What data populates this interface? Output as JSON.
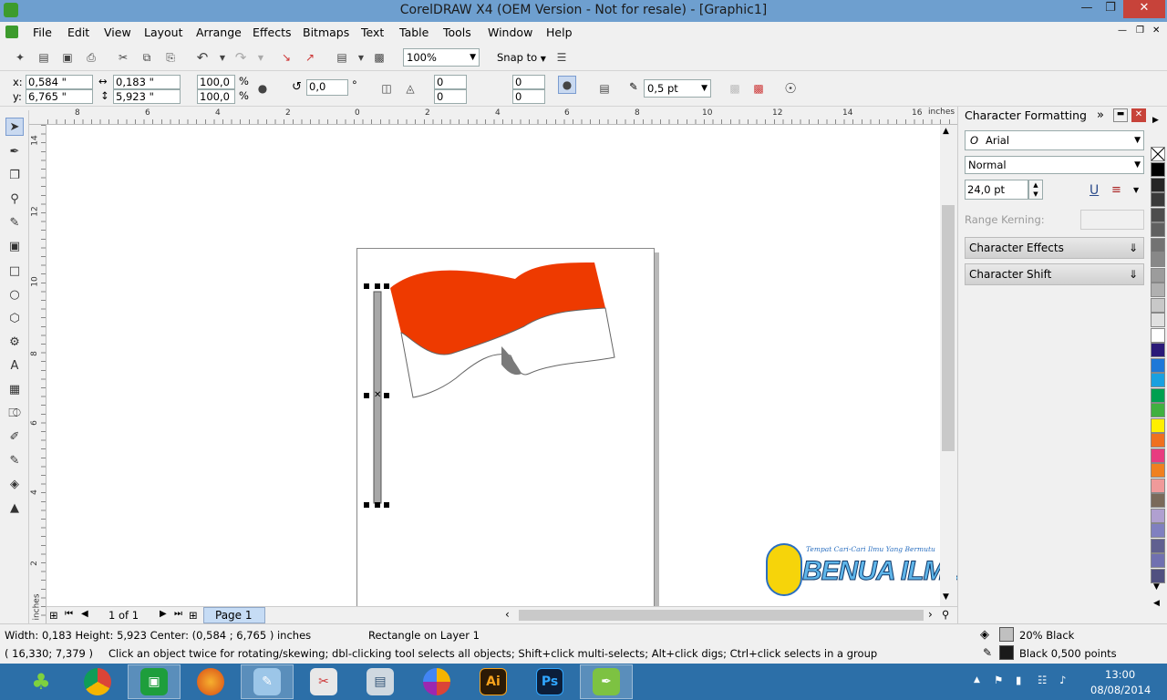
{
  "window": {
    "title": "CorelDRAW X4 (OEM Version - Not for resale) - [Graphic1]"
  },
  "menu": [
    "File",
    "Edit",
    "View",
    "Layout",
    "Arrange",
    "Effects",
    "Bitmaps",
    "Text",
    "Table",
    "Tools",
    "Window",
    "Help"
  ],
  "toolbar": {
    "zoom": "100%",
    "snap": "Snap to"
  },
  "props": {
    "x": "0,584 \"",
    "y": "6,765 \"",
    "w": "0,183 \"",
    "h": "5,923 \"",
    "sx": "100,0",
    "sy": "100,0",
    "pct": "%",
    "angle": "0,0",
    "deg": "°",
    "v1": "0",
    "v2": "0",
    "v3": "0",
    "v4": "0",
    "outline": "0,5 pt",
    "xl": "x:",
    "yl": "y:"
  },
  "ruler": {
    "h": [
      "8",
      "6",
      "4",
      "2",
      "0",
      "2",
      "4",
      "6",
      "8",
      "10",
      "12",
      "14",
      "16"
    ],
    "unit": "inches",
    "v": [
      "14",
      "12",
      "10",
      "8",
      "6",
      "4",
      "2"
    ],
    "vunit": "inches"
  },
  "docker": {
    "title": "Character Formatting",
    "font": "Arial",
    "style": "Normal",
    "size": "24,0 pt",
    "range_kerning": "Range Kerning:",
    "effects": "Character Effects",
    "shift": "Character Shift"
  },
  "palette": [
    "#000000",
    "#262626",
    "#3a3a3a",
    "#4d4d4d",
    "#606060",
    "#737373",
    "#888888",
    "#9c9c9c",
    "#b0b0b0",
    "#c8c8c8",
    "#e0e0e0",
    "#ffffff",
    "#2a1a78",
    "#1e78d8",
    "#1aa0e0",
    "#00a050",
    "#40b040",
    "#ffef00",
    "#f07020",
    "#e83c80",
    "#f08020",
    "#f09a9a",
    "#7a6a5a",
    "#b0a0d0",
    "#8080c0",
    "#606090",
    "#7070b0",
    "#505080"
  ],
  "pages": {
    "count": "1 of 1",
    "tab": "Page 1"
  },
  "status": {
    "dims": "Width: 0,183  Height: 5,923  Center: (0,584 ; 6,765 )  inches",
    "obj": "Rectangle on Layer 1",
    "coords": "( 16,330; 7,379 )",
    "hint": "Click an object twice for rotating/skewing; dbl-clicking tool selects all objects; Shift+click multi-selects; Alt+click digs; Ctrl+click selects in a group",
    "fill": "20% Black",
    "outline": "Black  0,500 points",
    "fill_color": "#c0c0c0",
    "outline_color": "#1a1a1a"
  },
  "watermark": {
    "tagline": "Tempat Cari-Cari Ilmu Yang Bermutu",
    "name": "BENUA ILMU"
  },
  "clock": {
    "time": "13:00",
    "date": "08/08/2014"
  },
  "colors": {
    "flag_red": "#ee3a00",
    "flag_white": "#ffffff",
    "title_bar": "#6e9fcf",
    "taskbar": "#2c6fa8"
  }
}
